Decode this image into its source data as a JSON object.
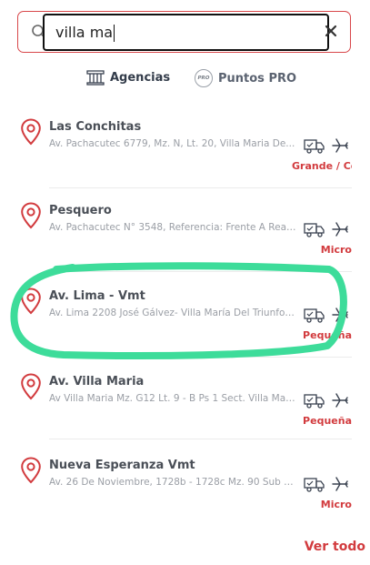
{
  "search": {
    "value": "villa ma",
    "placeholder": ""
  },
  "tabs": [
    {
      "label": "Agencias",
      "icon": "building-icon",
      "active": true
    },
    {
      "label": "Puntos PRO",
      "icon": "pro-badge-icon",
      "active": false
    }
  ],
  "pro_badge_text": "PRO",
  "results": [
    {
      "title": "Las Conchitas",
      "address": "Av. Pachacutec 6779, Mz. N, Lt. 20, Villa Maria De...",
      "size": "Grande / Co",
      "services": [
        "truck-icon",
        "plane-icon"
      ]
    },
    {
      "title": "Pesquero",
      "address": "Av. Pachacutec N° 3548, Referencia: Frente A Real...",
      "size": "Micro",
      "services": [
        "truck-icon",
        "plane-icon"
      ]
    },
    {
      "title": "Av. Lima - Vmt",
      "address": "Av. Lima 2208 José Gálvez- Villa María Del Triunfo,...",
      "size": "Pequeña",
      "services": [
        "truck-icon",
        "plane-icon"
      ],
      "circled": true
    },
    {
      "title": "Av. Villa Maria",
      "address": "Av Villa Maria Mz. G12 Lt. 9 - B Ps 1 Sect. Villa Mari...",
      "size": "Pequeña",
      "services": [
        "truck-icon",
        "plane-icon"
      ]
    },
    {
      "title": "Nueva Esperanza Vmt",
      "address": "Av. 26 De Noviembre, 1728b - 1728c Mz. 90 Sub Lot...",
      "size": "Micro",
      "services": [
        "truck-icon",
        "plane-icon"
      ]
    }
  ],
  "footer": {
    "see_all": "Ver todo"
  },
  "colors": {
    "accent": "#d23b3e",
    "highlight": "#3ddc9a",
    "title_text": "#4a4f57",
    "address_text": "#9a9ea5"
  }
}
